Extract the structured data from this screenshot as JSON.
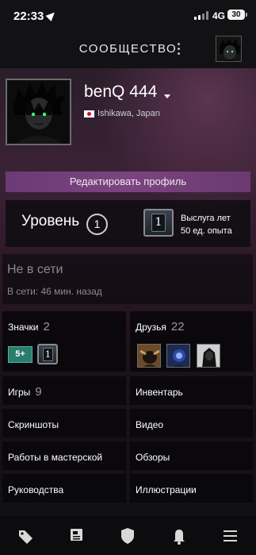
{
  "status_bar": {
    "time": "22:33",
    "network": "4G",
    "battery": "30"
  },
  "header": {
    "title": "СООБЩЕСТВО"
  },
  "profile": {
    "username": "benQ 444",
    "location": "Ishikawa, Japan",
    "edit_button": "Редактировать профиль"
  },
  "level": {
    "label": "Уровень",
    "value": "1",
    "years_badge": "1",
    "years_label": "Выслуга лет",
    "xp_label": "50 ед. опыта"
  },
  "online_status": {
    "title": "Не в сети",
    "subtitle": "В сети: 46 мин. назад"
  },
  "sections": {
    "badges": {
      "label": "Значки",
      "count": "2",
      "badge_level_text": "5+",
      "badge_years_text": "1"
    },
    "friends": {
      "label": "Друзья",
      "count": "22"
    },
    "games": {
      "label": "Игры",
      "count": "9"
    },
    "inventory": {
      "label": "Инвентарь"
    },
    "screenshots": {
      "label": "Скриншоты"
    },
    "video": {
      "label": "Видео"
    },
    "workshop": {
      "label": "Работы в мастерской"
    },
    "reviews": {
      "label": "Обзоры"
    },
    "guides": {
      "label": "Руководства"
    },
    "artwork": {
      "label": "Иллюстрации"
    }
  },
  "bottom_nav": {
    "items": [
      "tag-icon",
      "news-icon",
      "shield-icon",
      "bell-icon",
      "menu-icon"
    ]
  },
  "colors": {
    "accent_purple": "#7b4480",
    "badge_green": "#2a7d6c"
  }
}
